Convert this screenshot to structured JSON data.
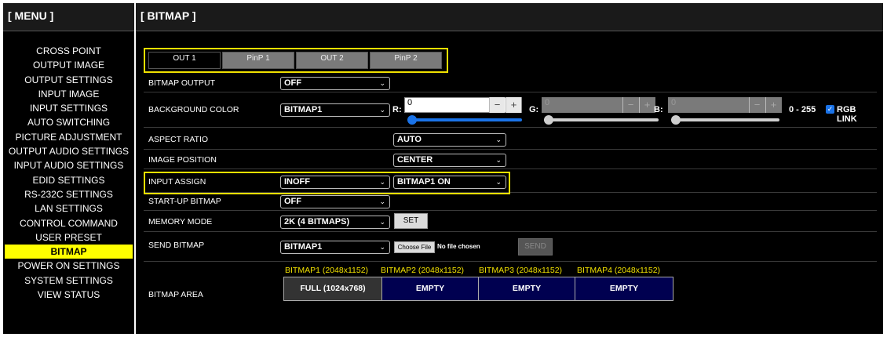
{
  "menu": {
    "title": "[ MENU ]",
    "items": [
      {
        "label": "CROSS POINT"
      },
      {
        "label": "OUTPUT IMAGE"
      },
      {
        "label": "OUTPUT SETTINGS"
      },
      {
        "label": "INPUT IMAGE"
      },
      {
        "label": "INPUT SETTINGS"
      },
      {
        "label": "AUTO SWITCHING"
      },
      {
        "label": "PICTURE ADJUSTMENT"
      },
      {
        "label": "OUTPUT AUDIO SETTINGS"
      },
      {
        "label": "INPUT AUDIO SETTINGS"
      },
      {
        "label": "EDID SETTINGS"
      },
      {
        "label": "RS-232C SETTINGS"
      },
      {
        "label": "LAN SETTINGS"
      },
      {
        "label": "CONTROL COMMAND"
      },
      {
        "label": "USER PRESET"
      },
      {
        "label": "BITMAP"
      },
      {
        "label": "POWER ON SETTINGS"
      },
      {
        "label": "SYSTEM SETTINGS"
      },
      {
        "label": "VIEW STATUS"
      }
    ],
    "active_index": 14
  },
  "page": {
    "title": "[ BITMAP ]"
  },
  "tabs": [
    {
      "label": "OUT 1",
      "selected": true
    },
    {
      "label": "PinP 1",
      "selected": false
    },
    {
      "label": "OUT 2",
      "selected": false
    },
    {
      "label": "PinP 2",
      "selected": false
    }
  ],
  "rows": {
    "bitmap_output": {
      "label": "BITMAP OUTPUT",
      "value": "OFF"
    },
    "background_color": {
      "label": "BACKGROUND COLOR",
      "value": "BITMAP1",
      "r_label": "R:",
      "r_value": "0",
      "g_label": "G:",
      "g_value": "0",
      "b_label": "B:",
      "b_value": "0",
      "range_text": "0 - 255",
      "rgb_link_label": "RGB LINK",
      "rgb_link_checked": true,
      "spin_minus": "−",
      "spin_plus": "+"
    },
    "aspect_ratio": {
      "label": "ASPECT RATIO",
      "value": "AUTO"
    },
    "image_position": {
      "label": "IMAGE POSITION",
      "value": "CENTER"
    },
    "input_assign": {
      "label": "INPUT ASSIGN",
      "value1": "INOFF",
      "value2": "BITMAP1 ON"
    },
    "startup_bitmap": {
      "label": "START-UP BITMAP",
      "value": "OFF"
    },
    "memory_mode": {
      "label": "MEMORY MODE",
      "value": "2K (4 BITMAPS)",
      "button": "SET"
    },
    "send_bitmap": {
      "label": "SEND BITMAP",
      "value": "BITMAP1",
      "choose_file": "Choose File",
      "file_status": "No file chosen",
      "send_button": "SEND"
    },
    "bitmap_area": {
      "label": "BITMAP AREA",
      "headers": [
        "BITMAP1 (2048x1152)",
        "BITMAP2 (2048x1152)",
        "BITMAP3 (2048x1152)",
        "BITMAP4 (2048x1152)"
      ],
      "cells": [
        "FULL (1024x768)",
        "EMPTY",
        "EMPTY",
        "EMPTY"
      ]
    }
  },
  "colors": {
    "highlight": "#f0e000",
    "accent_blue": "#1a73e8",
    "empty_cell": "#000050"
  }
}
